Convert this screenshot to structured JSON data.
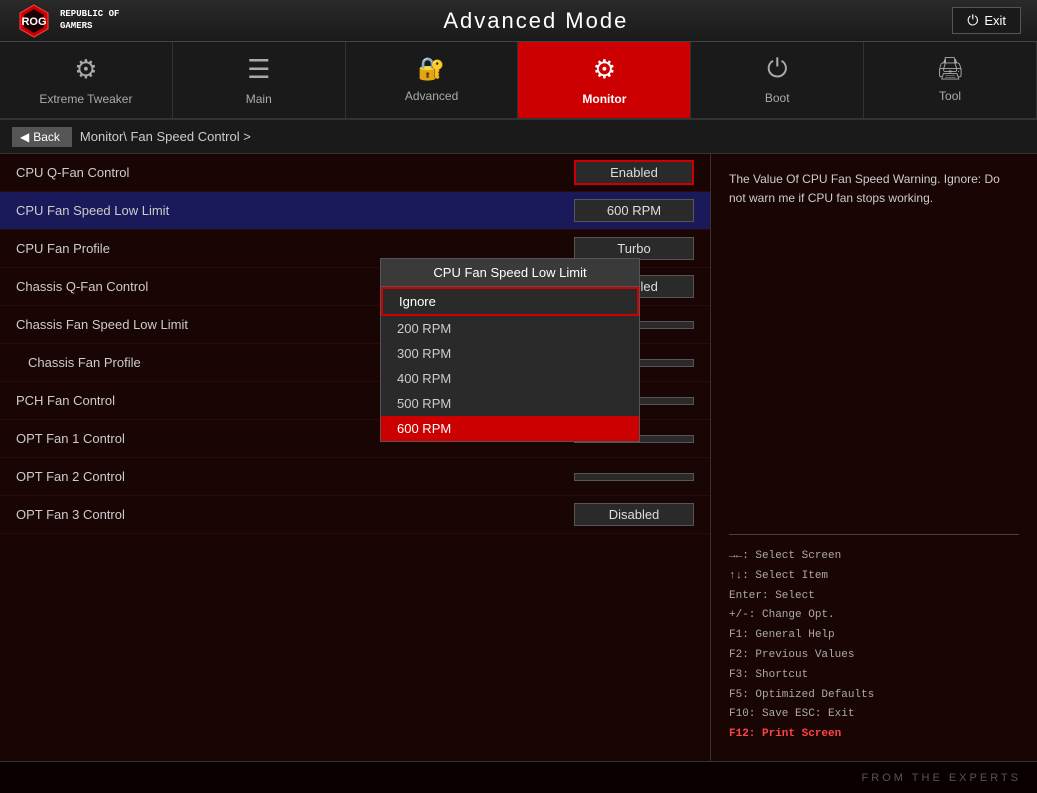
{
  "header": {
    "logo_line1": "REPUBLIC OF",
    "logo_line2": "GAMERS",
    "title": "Advanced Mode",
    "exit_label": "Exit"
  },
  "nav": {
    "tabs": [
      {
        "id": "extreme-tweaker",
        "label": "Extreme  Tweaker",
        "icon": "⚙",
        "active": false
      },
      {
        "id": "main",
        "label": "Main",
        "icon": "≡",
        "active": false
      },
      {
        "id": "advanced",
        "label": "Advanced",
        "icon": "🔒",
        "active": false
      },
      {
        "id": "monitor",
        "label": "Monitor",
        "icon": "⚡",
        "active": true
      },
      {
        "id": "boot",
        "label": "Boot",
        "icon": "⏻",
        "active": false
      },
      {
        "id": "tool",
        "label": "Tool",
        "icon": "🖨",
        "active": false
      }
    ]
  },
  "breadcrumb": {
    "back_label": "Back",
    "path": "Monitor\\ Fan Speed Control >"
  },
  "settings": {
    "rows": [
      {
        "label": "CPU Q-Fan Control",
        "value": "Enabled",
        "highlighted": false,
        "red_border": true
      },
      {
        "label": "CPU Fan Speed Low Limit",
        "value": "600 RPM",
        "highlighted": true,
        "red_border": false
      },
      {
        "label": "CPU Fan Profile",
        "value": "Turbo",
        "highlighted": false,
        "red_border": false
      },
      {
        "label": "Chassis Q-Fan Control",
        "value": "Enabled",
        "highlighted": false,
        "red_border": false
      },
      {
        "label": "Chassis Fan Speed Low Limit",
        "value": "",
        "highlighted": false,
        "red_border": false
      },
      {
        "label": "Chassis Fan Profile",
        "value": "",
        "highlighted": false,
        "red_border": false
      },
      {
        "label": "PCH Fan Control",
        "value": "",
        "highlighted": false,
        "red_border": false
      },
      {
        "label": "OPT Fan 1 Control",
        "value": "",
        "highlighted": false,
        "red_border": false
      },
      {
        "label": "OPT Fan 2 Control",
        "value": "",
        "highlighted": false,
        "red_border": false
      },
      {
        "label": "OPT Fan 3 Control",
        "value": "Disabled",
        "highlighted": false,
        "red_border": false
      }
    ]
  },
  "dropdown": {
    "title": "CPU Fan Speed Low Limit",
    "items": [
      {
        "label": "Ignore",
        "state": "outline"
      },
      {
        "label": "200 RPM",
        "state": "normal"
      },
      {
        "label": "300 RPM",
        "state": "normal"
      },
      {
        "label": "400 RPM",
        "state": "normal"
      },
      {
        "label": "500 RPM",
        "state": "normal"
      },
      {
        "label": "600 RPM",
        "state": "highlight"
      }
    ]
  },
  "help": {
    "text": "The Value Of CPU Fan Speed Warning. Ignore: Do not warn me if CPU fan stops working."
  },
  "keyboard_hints": [
    {
      "key": "→←:",
      "desc": "Select Screen"
    },
    {
      "key": "↑↓:",
      "desc": "Select Item"
    },
    {
      "key": "Enter:",
      "desc": "Select"
    },
    {
      "key": "+/-:",
      "desc": "Change Opt."
    },
    {
      "key": "F1:",
      "desc": "General Help"
    },
    {
      "key": "F2:",
      "desc": "Previous Values"
    },
    {
      "key": "F3:",
      "desc": "Shortcut"
    },
    {
      "key": "F5:",
      "desc": "Optimized Defaults"
    },
    {
      "key": "F10:",
      "desc": "Save  ESC: Exit"
    },
    {
      "key": "F12:",
      "desc": "Print Screen",
      "highlight": true
    }
  ],
  "bottom": {
    "text": "FROM THE EXPERTS"
  }
}
